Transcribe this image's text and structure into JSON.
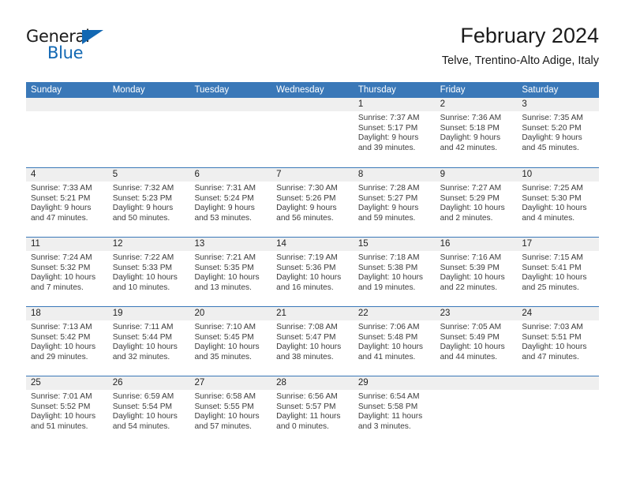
{
  "brand": {
    "name_part1": "General",
    "name_part2": "Blue",
    "triangle_color": "#1268b3"
  },
  "header": {
    "title": "February 2024",
    "subtitle": "Telve, Trentino-Alto Adige, Italy"
  },
  "theme": {
    "header_blue": "#3a78b8",
    "day_number_bg": "#efefef",
    "text": "#222222"
  },
  "weekdays": [
    "Sunday",
    "Monday",
    "Tuesday",
    "Wednesday",
    "Thursday",
    "Friday",
    "Saturday"
  ],
  "weeks": [
    [
      {
        "day": "",
        "empty": true
      },
      {
        "day": "",
        "empty": true
      },
      {
        "day": "",
        "empty": true
      },
      {
        "day": "",
        "empty": true
      },
      {
        "day": "1",
        "sunrise": "Sunrise: 7:37 AM",
        "sunset": "Sunset: 5:17 PM",
        "daylight1": "Daylight: 9 hours",
        "daylight2": "and 39 minutes."
      },
      {
        "day": "2",
        "sunrise": "Sunrise: 7:36 AM",
        "sunset": "Sunset: 5:18 PM",
        "daylight1": "Daylight: 9 hours",
        "daylight2": "and 42 minutes."
      },
      {
        "day": "3",
        "sunrise": "Sunrise: 7:35 AM",
        "sunset": "Sunset: 5:20 PM",
        "daylight1": "Daylight: 9 hours",
        "daylight2": "and 45 minutes."
      }
    ],
    [
      {
        "day": "4",
        "sunrise": "Sunrise: 7:33 AM",
        "sunset": "Sunset: 5:21 PM",
        "daylight1": "Daylight: 9 hours",
        "daylight2": "and 47 minutes."
      },
      {
        "day": "5",
        "sunrise": "Sunrise: 7:32 AM",
        "sunset": "Sunset: 5:23 PM",
        "daylight1": "Daylight: 9 hours",
        "daylight2": "and 50 minutes."
      },
      {
        "day": "6",
        "sunrise": "Sunrise: 7:31 AM",
        "sunset": "Sunset: 5:24 PM",
        "daylight1": "Daylight: 9 hours",
        "daylight2": "and 53 minutes."
      },
      {
        "day": "7",
        "sunrise": "Sunrise: 7:30 AM",
        "sunset": "Sunset: 5:26 PM",
        "daylight1": "Daylight: 9 hours",
        "daylight2": "and 56 minutes."
      },
      {
        "day": "8",
        "sunrise": "Sunrise: 7:28 AM",
        "sunset": "Sunset: 5:27 PM",
        "daylight1": "Daylight: 9 hours",
        "daylight2": "and 59 minutes."
      },
      {
        "day": "9",
        "sunrise": "Sunrise: 7:27 AM",
        "sunset": "Sunset: 5:29 PM",
        "daylight1": "Daylight: 10 hours",
        "daylight2": "and 2 minutes."
      },
      {
        "day": "10",
        "sunrise": "Sunrise: 7:25 AM",
        "sunset": "Sunset: 5:30 PM",
        "daylight1": "Daylight: 10 hours",
        "daylight2": "and 4 minutes."
      }
    ],
    [
      {
        "day": "11",
        "sunrise": "Sunrise: 7:24 AM",
        "sunset": "Sunset: 5:32 PM",
        "daylight1": "Daylight: 10 hours",
        "daylight2": "and 7 minutes."
      },
      {
        "day": "12",
        "sunrise": "Sunrise: 7:22 AM",
        "sunset": "Sunset: 5:33 PM",
        "daylight1": "Daylight: 10 hours",
        "daylight2": "and 10 minutes."
      },
      {
        "day": "13",
        "sunrise": "Sunrise: 7:21 AM",
        "sunset": "Sunset: 5:35 PM",
        "daylight1": "Daylight: 10 hours",
        "daylight2": "and 13 minutes."
      },
      {
        "day": "14",
        "sunrise": "Sunrise: 7:19 AM",
        "sunset": "Sunset: 5:36 PM",
        "daylight1": "Daylight: 10 hours",
        "daylight2": "and 16 minutes."
      },
      {
        "day": "15",
        "sunrise": "Sunrise: 7:18 AM",
        "sunset": "Sunset: 5:38 PM",
        "daylight1": "Daylight: 10 hours",
        "daylight2": "and 19 minutes."
      },
      {
        "day": "16",
        "sunrise": "Sunrise: 7:16 AM",
        "sunset": "Sunset: 5:39 PM",
        "daylight1": "Daylight: 10 hours",
        "daylight2": "and 22 minutes."
      },
      {
        "day": "17",
        "sunrise": "Sunrise: 7:15 AM",
        "sunset": "Sunset: 5:41 PM",
        "daylight1": "Daylight: 10 hours",
        "daylight2": "and 25 minutes."
      }
    ],
    [
      {
        "day": "18",
        "sunrise": "Sunrise: 7:13 AM",
        "sunset": "Sunset: 5:42 PM",
        "daylight1": "Daylight: 10 hours",
        "daylight2": "and 29 minutes."
      },
      {
        "day": "19",
        "sunrise": "Sunrise: 7:11 AM",
        "sunset": "Sunset: 5:44 PM",
        "daylight1": "Daylight: 10 hours",
        "daylight2": "and 32 minutes."
      },
      {
        "day": "20",
        "sunrise": "Sunrise: 7:10 AM",
        "sunset": "Sunset: 5:45 PM",
        "daylight1": "Daylight: 10 hours",
        "daylight2": "and 35 minutes."
      },
      {
        "day": "21",
        "sunrise": "Sunrise: 7:08 AM",
        "sunset": "Sunset: 5:47 PM",
        "daylight1": "Daylight: 10 hours",
        "daylight2": "and 38 minutes."
      },
      {
        "day": "22",
        "sunrise": "Sunrise: 7:06 AM",
        "sunset": "Sunset: 5:48 PM",
        "daylight1": "Daylight: 10 hours",
        "daylight2": "and 41 minutes."
      },
      {
        "day": "23",
        "sunrise": "Sunrise: 7:05 AM",
        "sunset": "Sunset: 5:49 PM",
        "daylight1": "Daylight: 10 hours",
        "daylight2": "and 44 minutes."
      },
      {
        "day": "24",
        "sunrise": "Sunrise: 7:03 AM",
        "sunset": "Sunset: 5:51 PM",
        "daylight1": "Daylight: 10 hours",
        "daylight2": "and 47 minutes."
      }
    ],
    [
      {
        "day": "25",
        "sunrise": "Sunrise: 7:01 AM",
        "sunset": "Sunset: 5:52 PM",
        "daylight1": "Daylight: 10 hours",
        "daylight2": "and 51 minutes."
      },
      {
        "day": "26",
        "sunrise": "Sunrise: 6:59 AM",
        "sunset": "Sunset: 5:54 PM",
        "daylight1": "Daylight: 10 hours",
        "daylight2": "and 54 minutes."
      },
      {
        "day": "27",
        "sunrise": "Sunrise: 6:58 AM",
        "sunset": "Sunset: 5:55 PM",
        "daylight1": "Daylight: 10 hours",
        "daylight2": "and 57 minutes."
      },
      {
        "day": "28",
        "sunrise": "Sunrise: 6:56 AM",
        "sunset": "Sunset: 5:57 PM",
        "daylight1": "Daylight: 11 hours",
        "daylight2": "and 0 minutes."
      },
      {
        "day": "29",
        "sunrise": "Sunrise: 6:54 AM",
        "sunset": "Sunset: 5:58 PM",
        "daylight1": "Daylight: 11 hours",
        "daylight2": "and 3 minutes."
      },
      {
        "day": "",
        "empty": true
      },
      {
        "day": "",
        "empty": true
      }
    ]
  ]
}
